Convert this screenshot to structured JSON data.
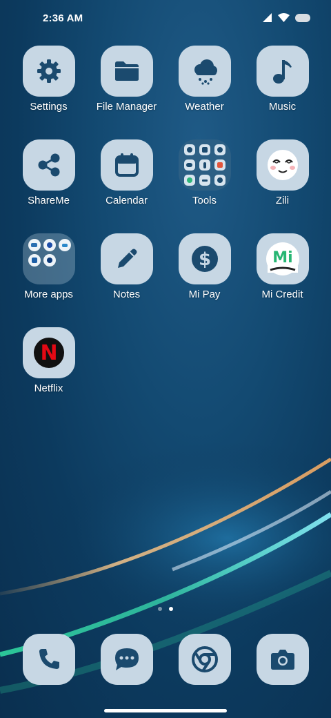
{
  "status_bar": {
    "time": "2:36 AM",
    "icons": [
      "signal-icon",
      "wifi-icon",
      "battery-icon"
    ]
  },
  "apps": [
    {
      "name": "settings",
      "label": "Settings",
      "icon": "gear-icon"
    },
    {
      "name": "file-manager",
      "label": "File Manager",
      "icon": "folder-icon"
    },
    {
      "name": "weather",
      "label": "Weather",
      "icon": "cloud-snow-icon"
    },
    {
      "name": "music",
      "label": "Music",
      "icon": "music-note-icon"
    },
    {
      "name": "shareme",
      "label": "ShareMe",
      "icon": "share-icon"
    },
    {
      "name": "calendar",
      "label": "Calendar",
      "icon": "calendar-icon"
    },
    {
      "name": "tools",
      "label": "Tools",
      "icon": "tools-folder-icon"
    },
    {
      "name": "zili",
      "label": "Zili",
      "icon": "smiley-face-icon"
    },
    {
      "name": "more-apps",
      "label": "More apps",
      "icon": "apps-folder-icon"
    },
    {
      "name": "notes",
      "label": "Notes",
      "icon": "pencil-icon"
    },
    {
      "name": "mi-pay",
      "label": "Mi Pay",
      "icon": "dollar-icon"
    },
    {
      "name": "mi-credit",
      "label": "Mi Credit",
      "icon": "mi-credit-logo-icon",
      "logo_text": "Mi"
    },
    {
      "name": "netflix",
      "label": "Netflix",
      "icon": "netflix-logo-icon",
      "logo_text": "N"
    }
  ],
  "page_indicator": {
    "count": 2,
    "active": 2
  },
  "dock": [
    {
      "name": "phone",
      "icon": "phone-icon"
    },
    {
      "name": "messages",
      "icon": "message-icon"
    },
    {
      "name": "chrome",
      "icon": "chrome-icon"
    },
    {
      "name": "camera",
      "icon": "camera-icon"
    }
  ],
  "colors": {
    "icon_background": "#c7d7e4",
    "glyph": "#1b4a6e",
    "wallpaper_dark": "#0a2f4f",
    "wallpaper_mid": "#134a72",
    "streak_orange": "#f0b36a",
    "streak_green": "#35e0a6"
  }
}
